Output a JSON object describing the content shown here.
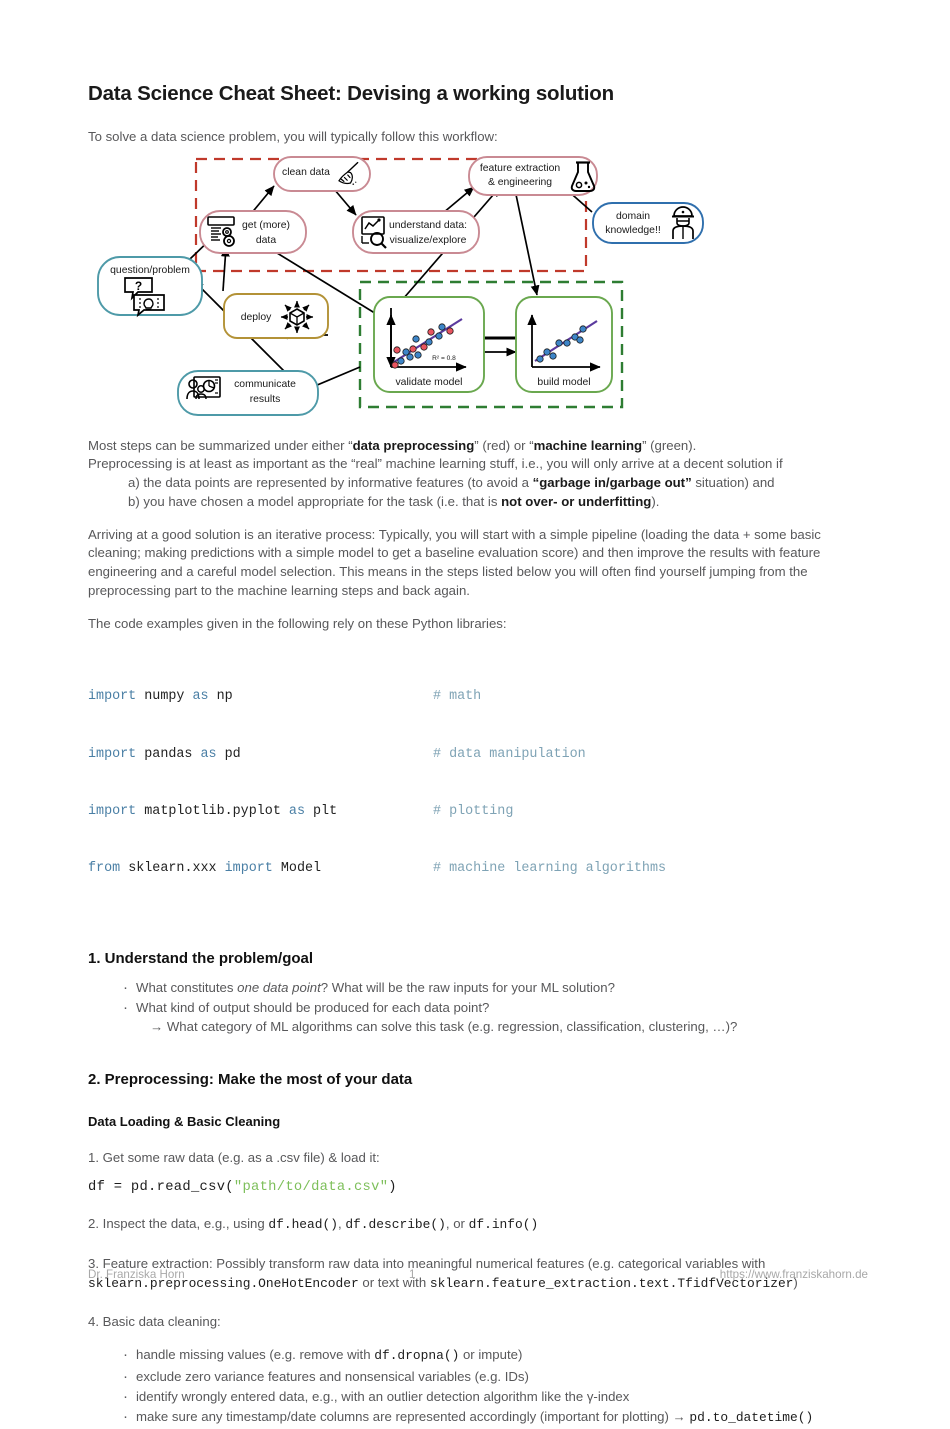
{
  "document": {
    "title": "Data Science Cheat Sheet: Devising a working solution",
    "intro": "To solve a data science problem, you will typically follow this workflow:"
  },
  "diagram": {
    "name": "data-science-workflow-diagram",
    "groups": [
      {
        "id": "preprocessing",
        "label": "data preprocessing",
        "color": "#c0392b",
        "style": "dashed"
      },
      {
        "id": "machine-learning",
        "label": "machine learning",
        "color": "#2e7d32",
        "style": "dashed"
      }
    ],
    "nodes": [
      {
        "id": "clean-data",
        "label": "clean data",
        "icon": "broom-icon",
        "border": "#c98a93"
      },
      {
        "id": "get-more-data",
        "label_line1": "get (more)",
        "label_line2": "data",
        "icon": "database-gears-icon",
        "border": "#c98a93"
      },
      {
        "id": "understand-data",
        "label_line1": "understand data:",
        "label_line2": "visualize/explore",
        "icon": "chart-magnifier-icon",
        "border": "#c98a93"
      },
      {
        "id": "feature-extraction",
        "label_line1": "feature extraction",
        "label_line2": "& engineering",
        "icon": "flask-icon",
        "border": "#c98a93"
      },
      {
        "id": "domain-knowledge",
        "label_line1": "domain",
        "label_line2": "knowledge!!",
        "icon": "worker-icon",
        "border": "#2f6fad"
      },
      {
        "id": "question-problem",
        "label": "question/problem",
        "icon": "question-bulb-icon",
        "border": "#4e9aa8"
      },
      {
        "id": "deploy",
        "label": "deploy",
        "icon": "cube-arrows-icon",
        "border": "#b39237"
      },
      {
        "id": "communicate-results",
        "label_line1": "communicate",
        "label_line2": "results",
        "icon": "presentation-icon",
        "border": "#4e9aa8"
      },
      {
        "id": "validate-model",
        "label": "validate model",
        "icon": "scatter-r2-icon",
        "annotation": "R² = 0.8",
        "border": "#6aa84f"
      },
      {
        "id": "build-model",
        "label": "build model",
        "icon": "scatter-icon",
        "border": "#6aa84f"
      }
    ]
  },
  "summary": {
    "line1_a": "Most steps can be summarized under either “",
    "line1_b": "data preprocessing",
    "line1_c": "” (red) or “",
    "line1_d": "machine learning",
    "line1_e": "” (green).",
    "line2": "Preprocessing is at least as important as the “real” machine learning stuff, i.e., you will only arrive at a decent solution if",
    "item_a_pre": "a) the data points are represented by informative features (to avoid a ",
    "item_a_bold": "“garbage in/garbage out”",
    "item_a_post": " situation) and",
    "item_b_pre": "b) you have chosen a model appropriate for the task (i.e. that is ",
    "item_b_bold": "not over- or underfitting",
    "item_b_post": ")."
  },
  "iterative": {
    "text": "Arriving at a good solution is an iterative process: Typically, you will start with a simple pipeline (loading the data + some basic cleaning; making predictions with a simple model to get a baseline evaluation score) and then improve the results with feature engineering and a careful model selection.  This means in the steps listed below you will often find yourself jumping from the preprocessing part to the machine learning steps and back again.",
    "libs_intro": "The code examples given in the following rely on these Python libraries:"
  },
  "code_imports": [
    {
      "kw1": "import",
      "rest": " numpy ",
      "kw2": "as",
      "tail": " np",
      "comment": "# math"
    },
    {
      "kw1": "import",
      "rest": " pandas ",
      "kw2": "as",
      "tail": " pd",
      "comment": "# data manipulation"
    },
    {
      "kw1": "import",
      "rest": " matplotlib.pyplot ",
      "kw2": "as",
      "tail": " plt",
      "comment": "# plotting"
    },
    {
      "kw1": "from",
      "rest": " sklearn.xxx ",
      "kw2": "import",
      "tail": " Model",
      "comment": "# machine learning algorithms"
    }
  ],
  "section1": {
    "heading": "1. Understand the problem/goal",
    "bullet1_a": "What constitutes ",
    "bullet1_italic": "one data point",
    "bullet1_b": "? What will be the raw inputs for your ML solution?",
    "bullet2": "What kind of output should be produced for each data point?",
    "bullet2_sub": "→ What category of ML algorithms can solve this task (e.g. regression, classification, clustering, …)?"
  },
  "section2": {
    "heading": "2. Preprocessing: Make the most of your data",
    "subheading": "Data Loading & Basic Cleaning",
    "step1": "1. Get some raw data (e.g. as a .csv file) & load it:",
    "step1_code_pre": "df = pd.read_csv(",
    "step1_code_str": "\"path/to/data.csv\"",
    "step1_code_post": ")",
    "step2_a": "2. Inspect the data, e.g., using ",
    "step2_code1": "df.head()",
    "step2_b": ", ",
    "step2_code2": "df.describe()",
    "step2_c": ", or ",
    "step2_code3": "df.info()",
    "step3_line1": "3. Feature extraction: Possibly transform raw data into meaningful numerical features (e.g. categorical variables with",
    "step3_code1": "sklearn.preprocessing.OneHotEncoder",
    "step3_mid": " or text with ",
    "step3_code2": "sklearn.feature_extraction.text.TfidfVectorizer",
    "step3_end": ")",
    "step4": "4. Basic data cleaning:",
    "clean_b1_a": "handle missing values (e.g. remove with ",
    "clean_b1_code": "df.dropna()",
    "clean_b1_b": " or impute)",
    "clean_b2": "exclude zero variance features and nonsensical variables (e.g. IDs)",
    "clean_b3": "identify wrongly entered data, e.g., with an outlier detection algorithm like the γ-index",
    "clean_b4_a": "make sure any timestamp/date columns are represented accordingly (important for plotting) → ",
    "clean_b4_code": "pd.to_datetime()"
  },
  "footer": {
    "author": "Dr. Franziska Horn",
    "page": "1",
    "url": "https://www.franziskahorn.de"
  },
  "colors": {
    "preprocessing_red": "#c0392b",
    "ml_green": "#2e7d32",
    "node_rose": "#c98a93",
    "node_teal": "#4e9aa8",
    "node_gold": "#b39237",
    "node_blue": "#2f6fad",
    "node_green": "#6aa84f",
    "scatter_blue": "#3d85c8",
    "scatter_red": "#e8545f",
    "regression_purple": "#5b3a9e",
    "code_keyword": "#4a7fa5",
    "code_comment": "#7fa3b5",
    "code_string": "#7dbf5a"
  }
}
